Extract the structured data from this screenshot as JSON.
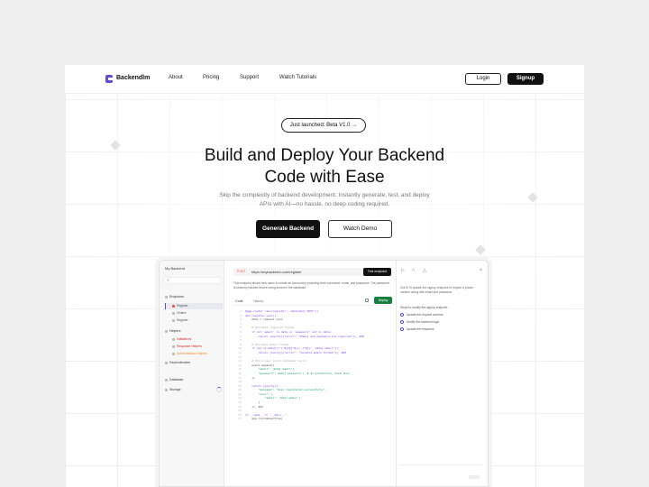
{
  "nav": {
    "brand": "Backendlm",
    "links": [
      "About",
      "Pricing",
      "Support",
      "Watch Tutorials"
    ],
    "login": "Login",
    "signup": "Signup"
  },
  "hero": {
    "badge": "Just launched: Beta V1.0 →",
    "headline_line1": "Build and Deploy Your Backend",
    "headline_line2": "Code with Ease",
    "subtitle": "Skip the complexity of backend development. Instantly generate, test, and deploy APIs with AI—no hassle, no deep coding required.",
    "primary_button": "Generate Backend",
    "secondary_button": "Watch Demo"
  },
  "app": {
    "sidebar": {
      "title": "My Backend",
      "search_icon": "search-icon",
      "endpoints_label": "Endpoints",
      "endpoints": [
        "Register",
        "Orders",
        "Register"
      ],
      "helpers_label": "Helpers",
      "helpers": [
        "Validations",
        "Response Helpers",
        "Authentication Helpers"
      ],
      "dependencies_label": "Dependencies",
      "database_label": "Database",
      "storage_label": "Storage"
    },
    "request": {
      "method": "POST",
      "url": "https://mybackend.com/register",
      "test_button": "Test endpoint",
      "description": "This endpoint allows new users to create an account by providing their username, email, and password. The password is securely hashed before being stored in the database."
    },
    "tabs": [
      "Code",
      "History"
    ],
    "deploy_button": "Deploy",
    "code": [
      "@app.route('/api/register', methods=['POST'])",
      "def register_user():",
      "    data = request.json",
      "",
      "    # Validate required fields",
      "    if not 'email' in data or 'password' not in data:",
      "        return jsonify({\"error\": \"Email and password are required\"}), 400",
      "",
      "    # Validate email format",
      "    if not re.match(r\"[^@]+@[^@]+\\.[^@]+\", data['email']):",
      "        return jsonify({\"error\": \"Invalid email format\"}), 400",
      "",
      "    # Store user (mock database logic)",
      "    users.append({",
      "        \"email\": data['email'],",
      "        \"password\": data['password']  # In production, hash this",
      "    })",
      "",
      "    return jsonify({",
      "        \"message\": \"User registered successfully\",",
      "        \"user\": {",
      "            \"email\": data['email']",
      "        }",
      "    }), 201",
      "",
      "if __name__ == '__main__':",
      "    app.run(debug=True)"
    ],
    "assistant": {
      "summary": "Got it! I'll update the signup endpoint to require a phone number along with email and password.",
      "steps_heading": "Steps to modify the signup endpoint",
      "steps": [
        "Update the request schema",
        "Modify the backend logic",
        "Update the response"
      ]
    }
  },
  "colors": {
    "accent": "#5b4fd8",
    "deploy": "#15803d",
    "primary_button": "#111111"
  }
}
